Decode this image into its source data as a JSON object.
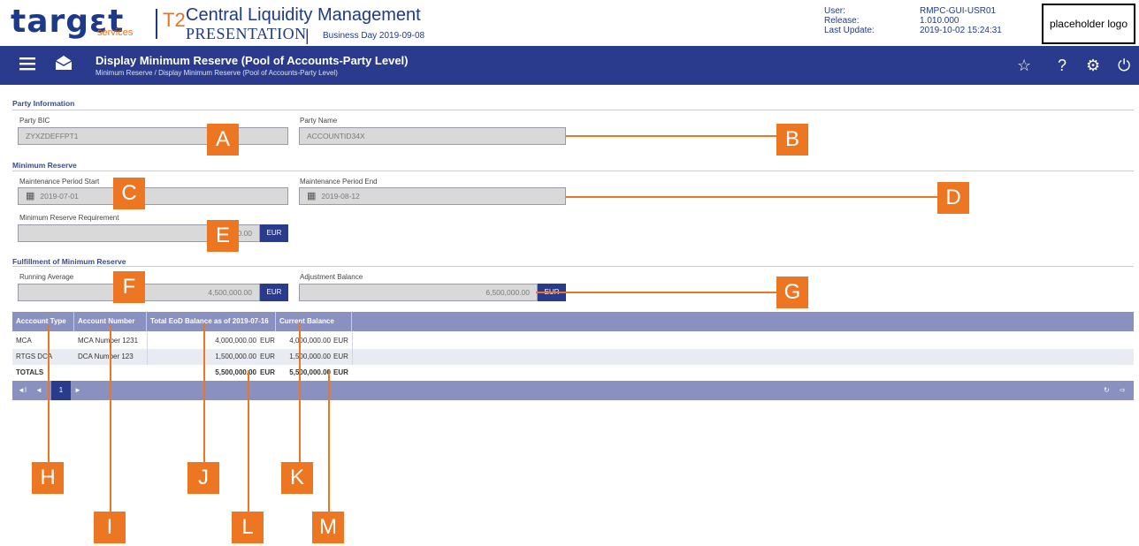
{
  "header": {
    "logo_text": "targεt",
    "logo_sub": "services",
    "t2": "T2",
    "app_title": "Central Liquidity Management",
    "environment": "PRESENTATION",
    "separator": "|",
    "business_day": "Business Day 2019-09-08",
    "meta_labels": [
      "User:",
      "Release:",
      "Last Update:"
    ],
    "meta_values": [
      "RMPC-GUI-USR01",
      "1.010.000",
      "2019-10-02 15:24:31"
    ],
    "logo_placeholder": "placeholder logo"
  },
  "navbar": {
    "title": "Display Minimum Reserve (Pool of Accounts-Party Level)",
    "breadcrumb": "Minimum Reserve  /  Display Minimum Reserve (Pool of Accounts-Party Level)",
    "icons": [
      "menu-icon",
      "envelope-icon",
      "star-icon",
      "help-icon",
      "settings-icon",
      "power-icon"
    ]
  },
  "party_info": {
    "section_title": "Party Information",
    "bic_label": "Party BIC",
    "bic_value": "ZYXZDEFFPT1",
    "name_label": "Party Name",
    "name_value": "ACCOUNTID34X"
  },
  "min_reserve": {
    "section_title": "Minimum Reserve",
    "start_label": "Maintenance Period Start",
    "start_value": "2019-07-01",
    "end_label": "Maintenance Period End",
    "end_value": "2019-08-12",
    "req_label": "Minimum Reserve Requirement",
    "req_value": "...0.00",
    "req_currency": "EUR"
  },
  "fulfillment": {
    "section_title": "Fulfillment of Minimum Reserve",
    "running_label": "Running Average",
    "running_value": "4,500,000.00",
    "running_currency": "EUR",
    "adjust_label": "Adjustment Balance",
    "adjust_value": "6,500,000.00",
    "adjust_currency": "EUR"
  },
  "table": {
    "headers": [
      "Acccount Type",
      "Account Number",
      "Total EoD Balance as of 2019-07-16",
      "Current Balance"
    ],
    "rows": [
      {
        "type": "MCA",
        "number": "MCA Number 1231",
        "eod": "4,000,000.00",
        "eod_cur": "EUR",
        "current": "4,000,000.00",
        "current_cur": "EUR"
      },
      {
        "type": "RTGS DCA",
        "number": "DCA Number 123",
        "eod": "1,500,000.00",
        "eod_cur": "EUR",
        "current": "1,500,000.00",
        "current_cur": "EUR"
      }
    ],
    "totals": {
      "label": "TOTALS",
      "eod": "5,500,000.00",
      "eod_cur": "EUR",
      "current": "5,500,000.00",
      "current_cur": "EUR"
    },
    "pager": {
      "first": "◄I",
      "prev": "◄",
      "page": "1",
      "next": "►",
      "refresh": "↻",
      "export": "⇨"
    }
  },
  "callouts": [
    "A",
    "B",
    "C",
    "D",
    "E",
    "F",
    "G",
    "H",
    "I",
    "J",
    "K",
    "L",
    "M"
  ],
  "colors": {
    "nav": "#2a3a8c",
    "accent": "#ec7622",
    "table_header": "#8a90c0",
    "field": "#d9d9d9"
  }
}
